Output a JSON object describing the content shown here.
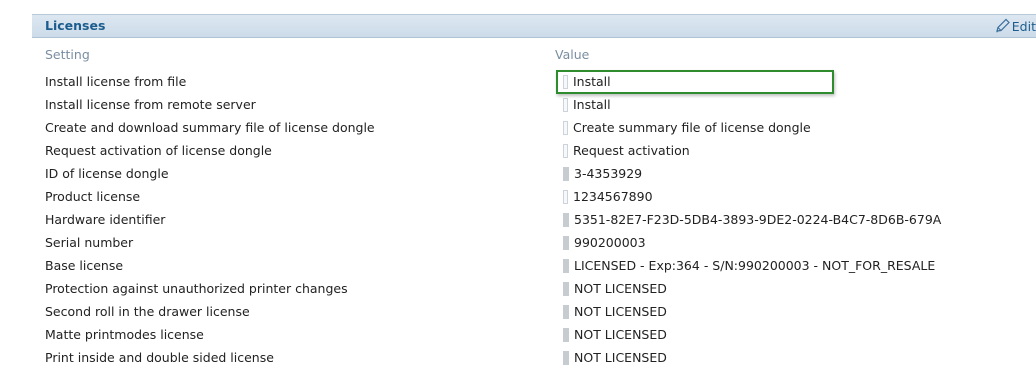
{
  "panel": {
    "title": "Licenses",
    "edit_label": "Edit",
    "columns": {
      "setting": "Setting",
      "value": "Value"
    }
  },
  "rows": [
    {
      "label": "Install license from file",
      "value": "Install",
      "kind": "action"
    },
    {
      "label": "Install license from remote server",
      "value": "Install",
      "kind": "action"
    },
    {
      "label": "Create and download summary file of license dongle",
      "value": "Create summary file of license dongle",
      "kind": "action"
    },
    {
      "label": "Request activation of license dongle",
      "value": "Request activation",
      "kind": "action"
    },
    {
      "label": "ID of license dongle",
      "value": "3-4353929",
      "kind": "readonly"
    },
    {
      "label": "Product license",
      "value": "1234567890",
      "kind": "action"
    },
    {
      "label": "Hardware identifier",
      "value": "5351-82E7-F23D-5DB4-3893-9DE2-0224-B4C7-8D6B-679A",
      "kind": "readonly"
    },
    {
      "label": "Serial number",
      "value": "990200003",
      "kind": "readonly"
    },
    {
      "label": "Base license",
      "value": "LICENSED - Exp:364 - S/N:990200003 - NOT_FOR_RESALE",
      "kind": "readonly"
    },
    {
      "label": "Protection against unauthorized printer changes",
      "value": "NOT LICENSED",
      "kind": "readonly"
    },
    {
      "label": "Second roll in the drawer license",
      "value": "NOT LICENSED",
      "kind": "readonly"
    },
    {
      "label": "Matte printmodes license",
      "value": "NOT LICENSED",
      "kind": "readonly"
    },
    {
      "label": "Print inside and double sided license",
      "value": "NOT LICENSED",
      "kind": "readonly"
    }
  ]
}
